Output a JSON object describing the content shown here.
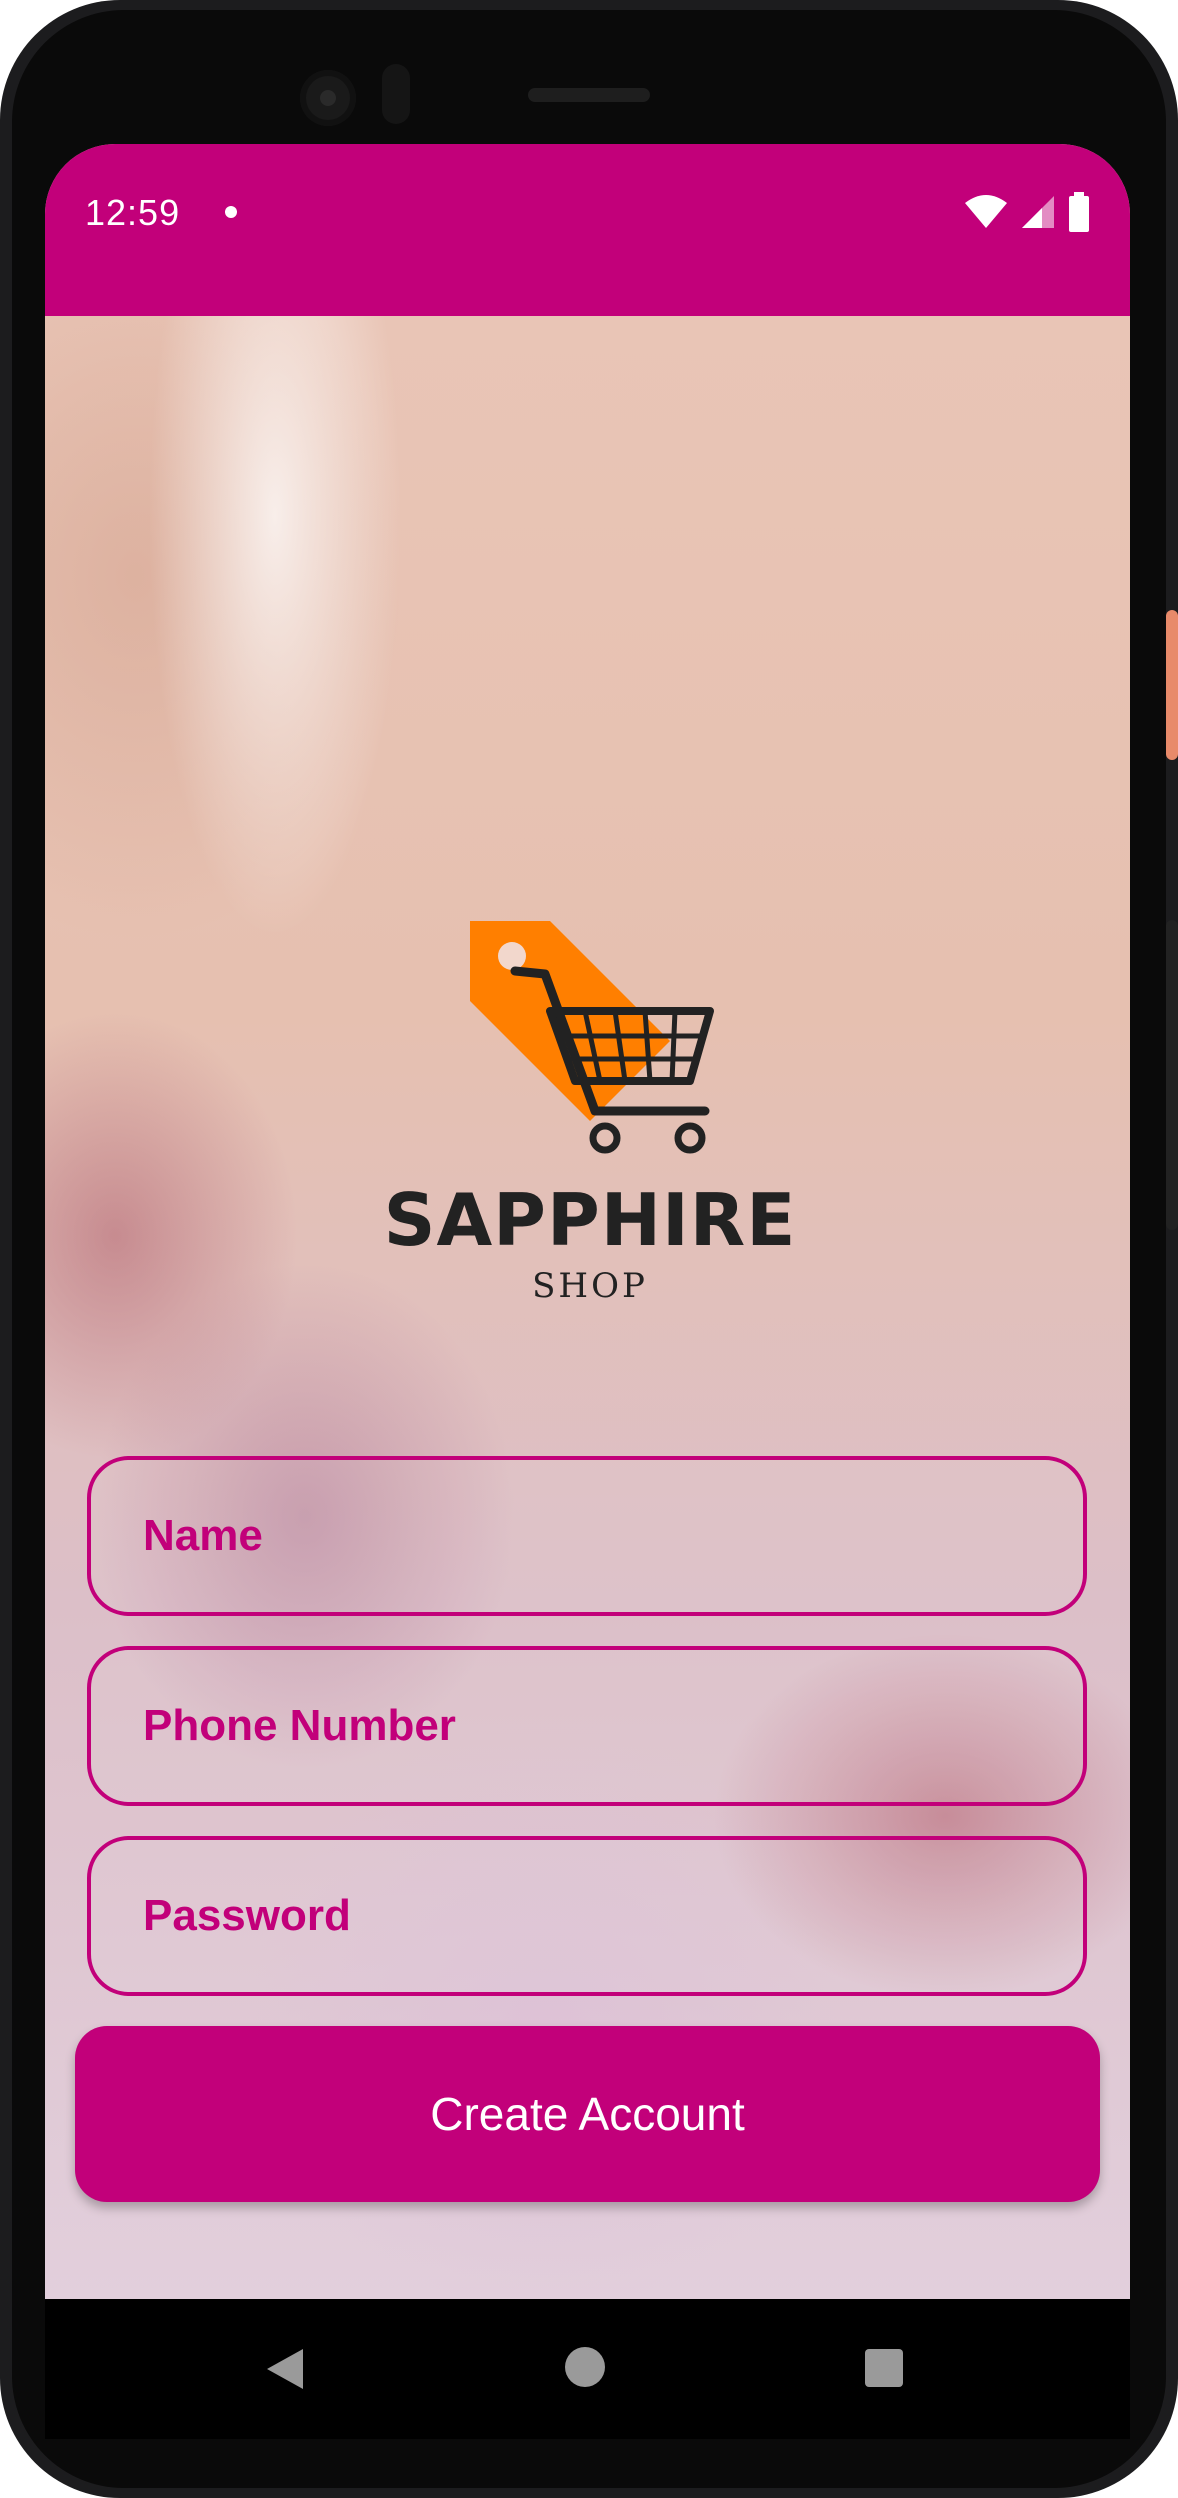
{
  "status_bar": {
    "time": "12:59",
    "icons": [
      "notification-dot",
      "wifi-icon",
      "signal-icon",
      "battery-icon"
    ],
    "background": "#c2007a"
  },
  "logo": {
    "icon": "shopping-cart-tag-icon",
    "title": "SAPPHIRE",
    "subtitle": "SHOP",
    "tag_color": "#ff7f00"
  },
  "form": {
    "name_placeholder": "Name",
    "phone_placeholder": "Phone Number",
    "password_placeholder": "Password",
    "submit_label": "Create Account"
  },
  "theme": {
    "accent": "#c2007a",
    "text_on_accent": "#ffffff",
    "logo_text": "#222222"
  },
  "nav_bar": {
    "icons": [
      "back-icon",
      "home-icon",
      "recents-icon"
    ]
  }
}
